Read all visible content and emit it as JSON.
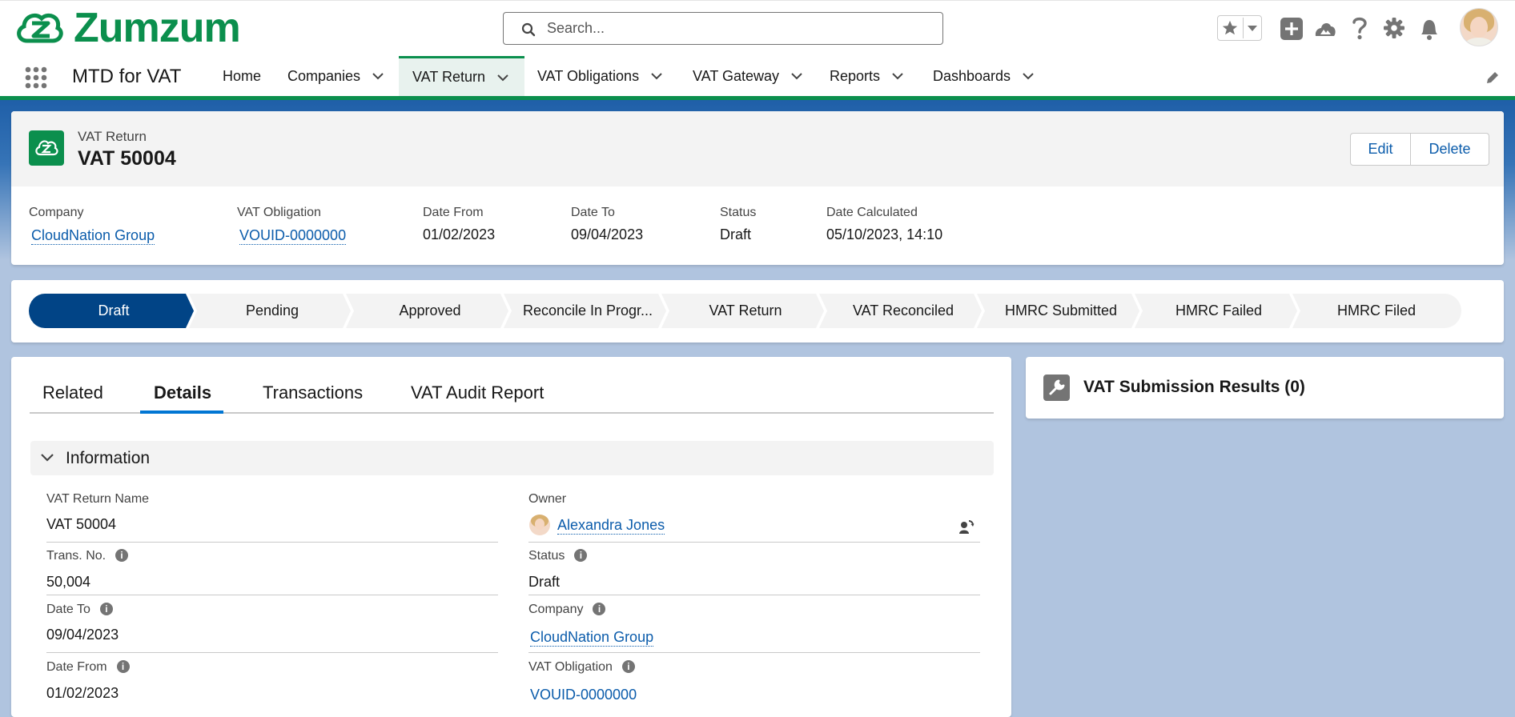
{
  "app": {
    "brand": "Zumzum",
    "name": "MTD for VAT"
  },
  "search": {
    "placeholder": "Search..."
  },
  "nav": {
    "items": [
      {
        "label": "Home"
      },
      {
        "label": "Companies"
      },
      {
        "label": "VAT Return"
      },
      {
        "label": "VAT Obligations"
      },
      {
        "label": "VAT Gateway"
      },
      {
        "label": "Reports"
      },
      {
        "label": "Dashboards"
      }
    ],
    "active": "VAT Return"
  },
  "record": {
    "object_label": "VAT Return",
    "title": "VAT 50004",
    "buttons": {
      "edit": "Edit",
      "delete": "Delete"
    },
    "highlights": [
      {
        "label": "Company",
        "value": "CloudNation Group"
      },
      {
        "label": "VAT Obligation",
        "value": "VOUID-0000000"
      },
      {
        "label": "Date From",
        "value": "01/02/2023"
      },
      {
        "label": "Date To",
        "value": "09/04/2023"
      },
      {
        "label": "Status",
        "value": "Draft"
      },
      {
        "label": "Date Calculated",
        "value": "05/10/2023, 14:10"
      }
    ]
  },
  "path": {
    "steps": [
      "Draft",
      "Pending",
      "Approved",
      "Reconcile In Progr...",
      "VAT Return",
      "VAT Reconciled",
      "HMRC Submitted",
      "HMRC Failed",
      "HMRC Filed"
    ],
    "current": "Draft"
  },
  "tabs": {
    "items": [
      "Related",
      "Details",
      "Transactions",
      "VAT Audit Report"
    ],
    "active": "Details"
  },
  "details": {
    "section_title": "Information",
    "fields": {
      "vat_return_name": {
        "label": "VAT Return Name",
        "value": "VAT 50004"
      },
      "owner": {
        "label": "Owner",
        "value": "Alexandra Jones"
      },
      "trans_no": {
        "label": "Trans. No.",
        "value": "50,004"
      },
      "status": {
        "label": "Status",
        "value": "Draft"
      },
      "date_to": {
        "label": "Date To",
        "value": "09/04/2023"
      },
      "company": {
        "label": "Company",
        "value": "CloudNation Group"
      },
      "date_from": {
        "label": "Date From",
        "value": "01/02/2023"
      },
      "vat_obligation": {
        "label": "VAT Obligation",
        "value": "VOUID-0000000"
      }
    }
  },
  "related_panel": {
    "title": "VAT Submission Results (0)"
  },
  "icons": [
    "zumzum-logo-icon",
    "search-icon",
    "favorites-star-icon",
    "chevron-down-icon",
    "global-actions-plus-icon",
    "trailhead-icon",
    "help-icon",
    "setup-gear-icon",
    "notifications-bell-icon",
    "user-avatar",
    "app-launcher-icon",
    "edit-nav-pencil-icon",
    "record-cloud-icon",
    "wrench-icon",
    "change-owner-icon",
    "info-icon"
  ],
  "colors": {
    "brand_green": "#0b8f4d",
    "link_blue": "#0b5cab",
    "path_active": "#014486",
    "path_inactive": "#f3f3f3",
    "page_bg": "#b0c4df"
  }
}
